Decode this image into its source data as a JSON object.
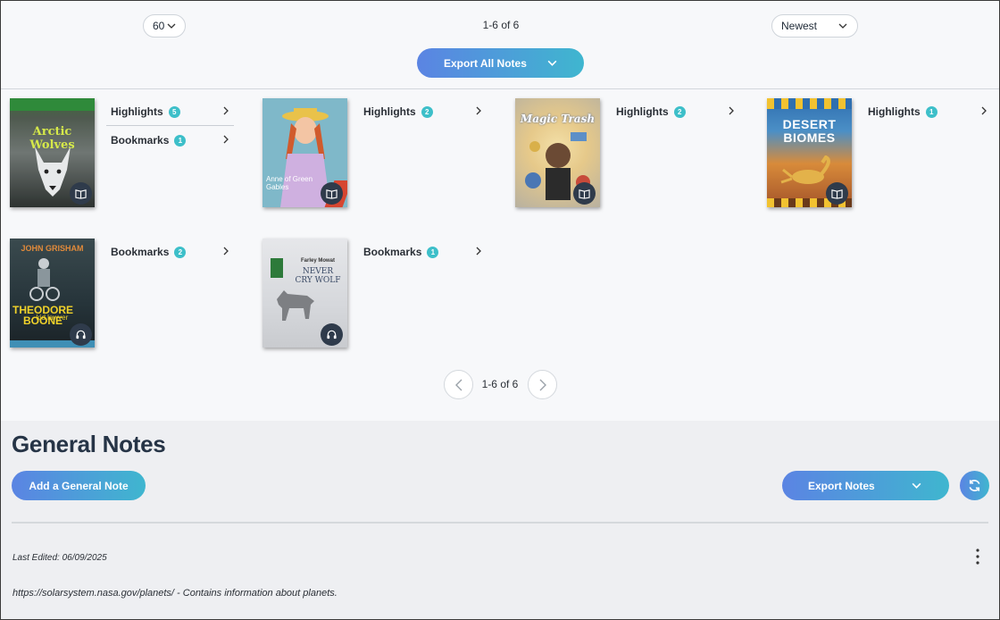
{
  "toolbar": {
    "per_page_value": "60",
    "range_text": "1-6 of 6",
    "sort_value": "Newest",
    "export_all_label": "Export All Notes"
  },
  "books": [
    {
      "cover_title": "Arctic Wolves",
      "cover_subtitle": "",
      "format": "book",
      "rows": [
        {
          "label": "Highlights",
          "count": "5"
        },
        {
          "label": "Bookmarks",
          "count": "1"
        }
      ]
    },
    {
      "cover_title": "Anne of Green Gables",
      "cover_subtitle": "",
      "format": "book",
      "rows": [
        {
          "label": "Highlights",
          "count": "2"
        }
      ]
    },
    {
      "cover_title": "Magic Trash",
      "cover_subtitle": "",
      "format": "book",
      "rows": [
        {
          "label": "Highlights",
          "count": "2"
        }
      ]
    },
    {
      "cover_title": "DESERT BIOMES",
      "cover_subtitle": "",
      "format": "book",
      "rows": [
        {
          "label": "Highlights",
          "count": "1"
        }
      ]
    },
    {
      "cover_title": "THEODORE BOONE",
      "cover_subtitle": "JOHN GRISHAM",
      "cover_tagline": "kid lawyer",
      "format": "audio",
      "rows": [
        {
          "label": "Bookmarks",
          "count": "2"
        }
      ]
    },
    {
      "cover_title": "NEVER CRY WOLF",
      "cover_subtitle": "Farley Mowat",
      "format": "audio",
      "rows": [
        {
          "label": "Bookmarks",
          "count": "1"
        }
      ]
    }
  ],
  "pagination": {
    "range_text": "1-6 of 6"
  },
  "general_notes": {
    "title": "General Notes",
    "add_label": "Add a General Note",
    "export_label": "Export Notes",
    "note": {
      "last_edited": "Last Edited: 06/09/2025",
      "text": "https://solarsystem.nasa.gov/planets/ - Contains information about planets."
    }
  },
  "icons": {
    "chevron": "chevron-down-icon",
    "row_chevron": "chevron-right-icon",
    "book": "open-book-icon",
    "audio": "headphones-icon",
    "refresh": "refresh-icon",
    "more": "more-vertical-icon"
  },
  "colors": {
    "accent_start": "#5b84e3",
    "accent_end": "#3fb6cf",
    "count_dot": "#3dbfc9",
    "badge": "#2f3b4b"
  }
}
